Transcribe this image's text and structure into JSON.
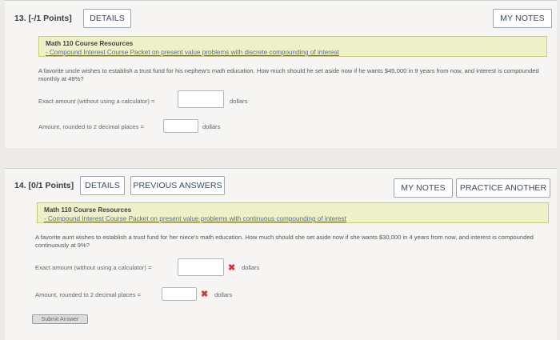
{
  "q13": {
    "header": "13.  [-/1 Points]",
    "details_label": "DETAILS",
    "my_notes_label": "MY NOTES",
    "resource_title": "Math 110 Course Resources",
    "resource_link": "- Compound Interest Course Packet on present value problems with discrete compounding of interest",
    "problem": "A favorite uncle wishes to establish a trust fund for his nephew's math education. How much should he set aside now if he wants $45,000 in 9 years from now, and interest is compounded monthly at 48%?",
    "exact_label": "Exact amount (without using a calculator) =",
    "exact_value": "",
    "exact_unit": "dollars",
    "rounded_label": "Amount, rounded to 2 decimal places =",
    "rounded_value": "",
    "rounded_unit": "dollars"
  },
  "q14": {
    "header": "14.  [0/1 Points]",
    "details_label": "DETAILS",
    "previous_answers_label": "PREVIOUS ANSWERS",
    "my_notes_label": "MY NOTES",
    "practice_another_label": "PRACTICE ANOTHER",
    "resource_title": "Math 110 Course Resources",
    "resource_link": "- Compound Interest Course Packet on present value problems with continuous compounding of interest",
    "problem": "A favorite aunt wishes to establish a trust fund for her niece's math education. How much should she set aside now if she wants $30,000 in 4 years from now, and interest is compounded continuously at 9%?",
    "exact_label": "Exact amount (without using a calculator) =",
    "exact_value": "",
    "exact_unit": "dollars",
    "rounded_label": "Amount, rounded to 2 decimal places =",
    "rounded_value": "",
    "rounded_unit": "dollars",
    "incorrect_mark": "✖",
    "submit_label": "Submit Answer"
  }
}
